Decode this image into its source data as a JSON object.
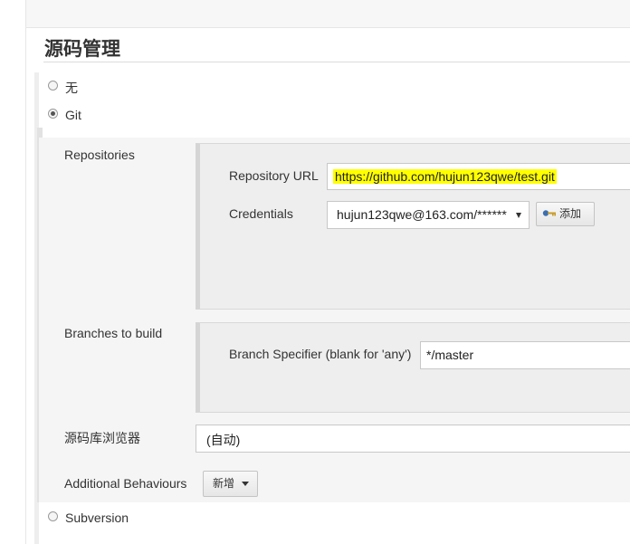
{
  "section": {
    "title": "源码管理"
  },
  "scm_options": {
    "none_label": "无",
    "git_label": "Git",
    "subversion_label": "Subversion",
    "selected": "Git"
  },
  "git": {
    "repositories_label": "Repositories",
    "repository_url_label": "Repository URL",
    "repository_url_value": "https://github.com/hujun123qwe/test.git",
    "credentials_label": "Credentials",
    "credentials_value": "hujun123qwe@163.com/******",
    "add_button_label": "添加",
    "branches_label": "Branches to build",
    "branch_specifier_label": "Branch Specifier (blank for 'any')",
    "branch_specifier_value": "*/master",
    "repo_browser_label": "源码库浏览器",
    "repo_browser_value": "(自动)",
    "additional_behaviours_label": "Additional Behaviours",
    "add_behaviour_button_label": "新增"
  },
  "colors": {
    "url_highlight": "#ffff00"
  }
}
